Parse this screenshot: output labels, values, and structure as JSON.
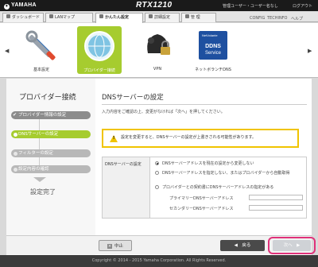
{
  "header": {
    "logo": "YAMAHA",
    "model": "RTX1210",
    "user_info": "管理ユーザー・ユーザー名なし",
    "logout": "ログアウト"
  },
  "nav": {
    "tabs": [
      "ダッシュボード",
      "LANマップ",
      "かんたん設定",
      "詳細設定",
      "管 理"
    ],
    "links": [
      "CONFIG",
      "TECHINFO",
      "ヘルプ"
    ]
  },
  "wizard": {
    "items": [
      {
        "label": "基本設定",
        "icon": "tools-icon"
      },
      {
        "label": "プロバイダー接続",
        "icon": "globe-icon"
      },
      {
        "label": "VPN",
        "icon": "vpn-lock-icon"
      },
      {
        "label": "ネットボランチDNS",
        "icon": "ddns-service-icon",
        "icon_text": [
          "NetVolante",
          "DDNS",
          "Service"
        ]
      }
    ]
  },
  "sidebar": {
    "title": "プロバイダー接続",
    "steps": [
      {
        "label": "プロバイダー情報の設定",
        "state": "done"
      },
      {
        "label": "DNSサーバーの設定",
        "state": "current"
      },
      {
        "label": "フィルターの設定",
        "state": "todo"
      },
      {
        "label": "設定内容の確認",
        "state": "todo"
      }
    ],
    "complete": "設定完了"
  },
  "content": {
    "title": "DNSサーバーの設定",
    "instruction": "入力内容をご確認の上、変更がなければ「次へ」を押してください。",
    "warning": "設定を変更すると、DNSサーバーの設定が上書きされる可能性があります。",
    "dns_label": "DNSサーバーの設定",
    "options": [
      "DNSサーバーアドレスを現在の設定から変更しない",
      "DNSサーバーアドレスを指定しない、またはプロバイダーから自動取得",
      "プロバイダーとの契約書にDNSサーバーアドレスの指定がある"
    ],
    "selected_option": 0,
    "primary_label": "プライマリーDNSサーバーアドレス",
    "secondary_label": "セカンダリーDNSサーバーアドレス",
    "primary_value": "",
    "secondary_value": ""
  },
  "buttons": {
    "cancel": "中止",
    "back": "◀　戻る",
    "next": "次へ　▶"
  },
  "footer": {
    "copyright": "Copyright © 2014 - 2015 Yamaha Corporation. All Rights Reserved."
  },
  "colors": {
    "accent_green": "#a6cc2f",
    "warning_yellow": "#f0c400",
    "highlight_pink": "#e0327a"
  }
}
